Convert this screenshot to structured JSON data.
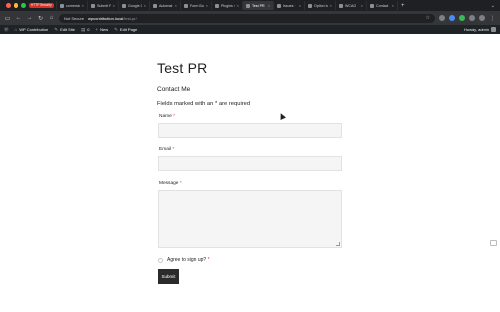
{
  "browser": {
    "tabs": [
      {
        "label": "",
        "badge": "HTTP Security"
      },
      {
        "label": "cornerstone"
      },
      {
        "label": "Submit Fo"
      },
      {
        "label": "Google Gr"
      },
      {
        "label": "Automat"
      },
      {
        "label": "Form Bui"
      },
      {
        "label": "Plugins ‹"
      },
      {
        "label": "Test PR",
        "active": true
      },
      {
        "label": "Issues ·"
      },
      {
        "label": "Option to"
      },
      {
        "label": "WCAG"
      },
      {
        "label": "Contact"
      }
    ],
    "address": {
      "security": "Not Secure",
      "host": "wpcontribution.local",
      "path": "/test-pr/"
    }
  },
  "adminbar": {
    "site_name": "WP Contribution",
    "edit_site": "Edit Site",
    "comments_count": "0",
    "new": "New",
    "edit_page": "Edit Page",
    "greeting": "Howdy, admin"
  },
  "page": {
    "title": "Test PR",
    "form_title": "Contact Me",
    "required_note": "Fields marked with an * are required"
  },
  "form": {
    "required_mark": "*",
    "fields": [
      {
        "label": "Name",
        "value": ""
      },
      {
        "label": "Email",
        "value": ""
      },
      {
        "label": "Message",
        "value": ""
      }
    ],
    "checkbox_label": "Agree to sign up?",
    "submit_label": "Submit"
  },
  "colors": {
    "required": "#d63638",
    "submit_bg": "#2b2b2b",
    "adminbar_bg": "#1d2327"
  }
}
